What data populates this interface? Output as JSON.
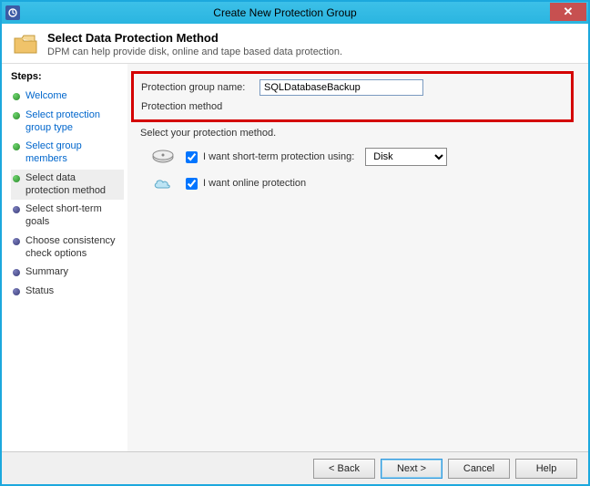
{
  "window": {
    "title": "Create New Protection Group"
  },
  "header": {
    "title": "Select Data Protection Method",
    "subtitle": "DPM can help provide disk, online and tape based data protection."
  },
  "sidebar": {
    "title": "Steps:",
    "items": [
      {
        "label": "Welcome",
        "state": "done",
        "link": true
      },
      {
        "label": "Select protection group type",
        "state": "done",
        "link": true
      },
      {
        "label": "Select group members",
        "state": "done",
        "link": true
      },
      {
        "label": "Select data protection method",
        "state": "active",
        "link": false
      },
      {
        "label": "Select short-term goals",
        "state": "pending",
        "link": false
      },
      {
        "label": "Choose consistency check options",
        "state": "pending",
        "link": false
      },
      {
        "label": "Summary",
        "state": "pending",
        "link": false
      },
      {
        "label": "Status",
        "state": "pending",
        "link": false
      }
    ]
  },
  "main": {
    "group_name_label": "Protection group name:",
    "group_name_value": "SQLDatabaseBackup",
    "method_section_label": "Protection method",
    "instruction": "Select your protection method.",
    "short_term_label": "I want short-term protection using:",
    "short_term_checked": true,
    "short_term_select_value": "Disk",
    "online_label": "I want online protection",
    "online_checked": true
  },
  "footer": {
    "back": "< Back",
    "next": "Next >",
    "cancel": "Cancel",
    "help": "Help"
  }
}
